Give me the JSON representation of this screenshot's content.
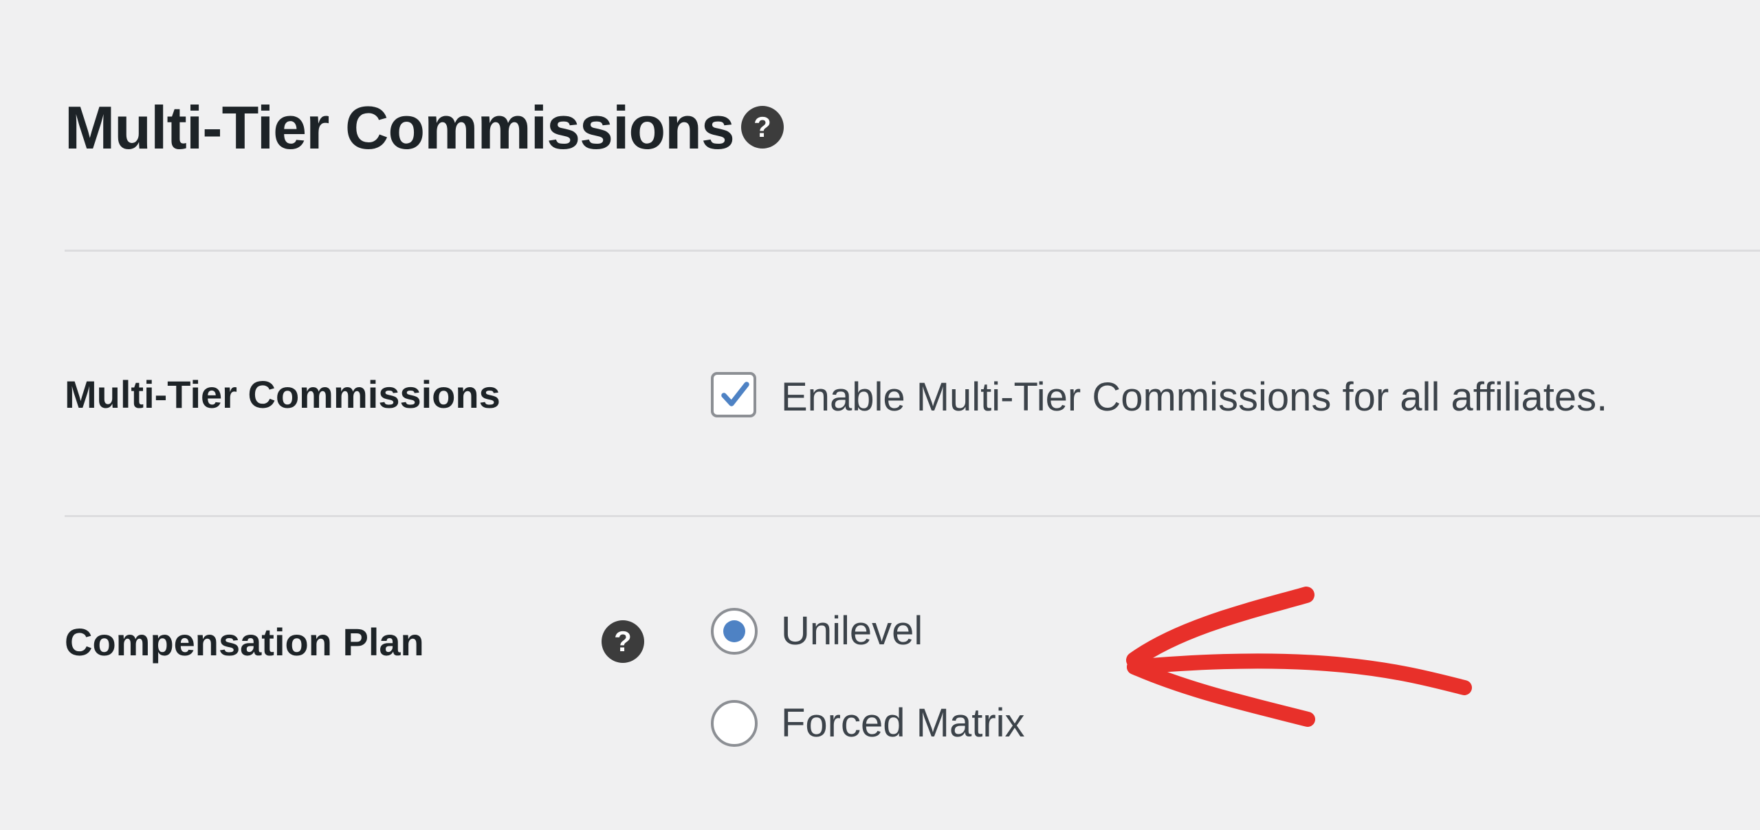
{
  "header": {
    "title": "Multi-Tier Commissions",
    "help_icon": "help-circle-icon"
  },
  "settings": {
    "multi_tier": {
      "label": "Multi-Tier Commissions",
      "checkbox_label": "Enable Multi-Tier Commissions for all affiliates.",
      "checked": true
    },
    "compensation_plan": {
      "label": "Compensation Plan",
      "help_icon": "help-circle-icon",
      "options": [
        {
          "label": "Unilevel",
          "selected": true
        },
        {
          "label": "Forced Matrix",
          "selected": false
        }
      ]
    }
  },
  "annotation": {
    "type": "arrow",
    "color": "#e8302a"
  },
  "colors": {
    "background": "#f0f0f1",
    "accent": "#4e82c4",
    "text": "#1d2327"
  }
}
